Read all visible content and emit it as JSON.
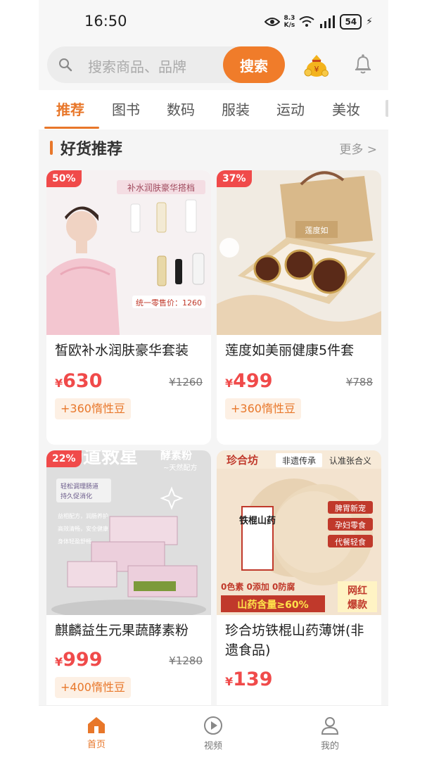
{
  "status_bar": {
    "time": "16:50",
    "net_speed_value": "8.3",
    "net_speed_unit": "K/s",
    "battery": "54"
  },
  "header": {
    "search_placeholder": "搜索商品、品牌",
    "search_button": "搜索"
  },
  "tabs": [
    {
      "label": "推荐",
      "active": true
    },
    {
      "label": "图书"
    },
    {
      "label": "数码"
    },
    {
      "label": "服装"
    },
    {
      "label": "运动"
    },
    {
      "label": "美妆"
    }
  ],
  "section": {
    "title": "好货推荐",
    "more": "更多 >"
  },
  "products": [
    {
      "discount": "50%",
      "title": "皙欧补水润肤豪华套装",
      "currency": "¥",
      "price": "630",
      "old_price": "¥1260",
      "beans": "+360惰性豆",
      "image": {
        "banner": "补水润肤豪华搭档",
        "price_line": "统一零售价：1260"
      }
    },
    {
      "discount": "37%",
      "title": "莲度如美丽健康5件套",
      "currency": "¥",
      "price": "499",
      "old_price": "¥788",
      "beans": "+360惰性豆",
      "image": {
        "box_label": "莲度如"
      }
    },
    {
      "discount": "22%",
      "title": "麒麟益生元果蔬酵素粉",
      "currency": "¥",
      "price": "999",
      "old_price": "¥1280",
      "beans": "+400惰性豆",
      "image": {
        "headline": "肠道救星",
        "tag": "酵素粉",
        "sub": "~天然配方",
        "note1": "轻松调理肠道",
        "note2": "持久促消化",
        "b1": "益相配方，润肠养护",
        "b2": "高效清畅，安全健康",
        "b3": "身体轻盈舒畅"
      }
    },
    {
      "discount": "",
      "title": "珍合坊铁棍山药薄饼(非遗食品)",
      "currency": "¥",
      "price": "139",
      "old_price": "",
      "beans": "",
      "image": {
        "brand": "珍合坊",
        "heritage": "非遗传承",
        "verify": "认准张合义",
        "pack": "铁棍山药",
        "tag1": "脾胃新宠",
        "tag2": "孕妇零食",
        "tag3": "代餐轻食",
        "zero": "0色素 0添加 0防腐",
        "content": "山药含量≥60%",
        "hot1": "网红",
        "hot2": "爆款"
      }
    }
  ],
  "bottom_nav": [
    {
      "label": "首页",
      "icon": "home-icon",
      "active": true
    },
    {
      "label": "视频",
      "icon": "play-icon"
    },
    {
      "label": "我的",
      "icon": "user-icon"
    }
  ],
  "colors": {
    "accent": "#f07c2a",
    "price": "#f04a4a",
    "beans_bg": "#fdf0e4"
  }
}
